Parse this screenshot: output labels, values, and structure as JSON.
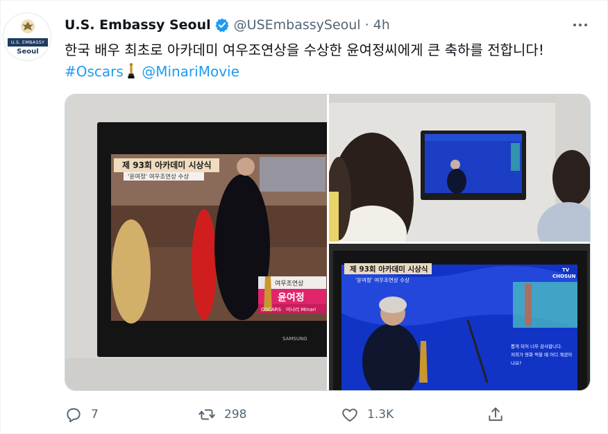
{
  "author": {
    "display_name": "U.S. Embassy Seoul",
    "handle": "@USEmbassySeoul",
    "separator": "·",
    "time": "4h",
    "avatar_banner": "U.S. EMBASSY",
    "avatar_city": "Seoul",
    "verified": true
  },
  "tweet": {
    "text_main": "한국 배우 최초로 아카데미 여우조연상을 수상한 윤여정씨에게 큰 축하를 전합니다!",
    "hashtag": "#Oscars",
    "mention": "@MinariMovie"
  },
  "media": {
    "photo1": {
      "banner_title": "제 93회 아카데미 시상식",
      "banner_subtitle": "'윤여정' 여우조연상 수상",
      "award_label": "여우조연상",
      "winner_name": "윤여정",
      "award_brand": "OSCARS",
      "film_label": "미나리 Minari",
      "tv_brand": "SAMSUNG"
    },
    "photo3": {
      "banner_title": "제 93회 아카데미 시상식",
      "banner_subtitle": "'윤여정' 여우조연상 수상",
      "channel_top": "TV",
      "channel_name": "CHOSUN",
      "subtitle_line1": "뽑게 되어 너무 감사합니다.",
      "subtitle_line2": "저희가 영화 찍을 때 어디 계셨어",
      "subtitle_line3": "나요?"
    }
  },
  "actions": {
    "replies": "7",
    "retweets": "298",
    "likes": "1.3K"
  },
  "colors": {
    "link": "#1d9bf0",
    "secondary_text": "#536471",
    "verified": "#1d9bf0"
  },
  "icons": [
    "verified-badge-icon",
    "more-icon",
    "reply-icon",
    "retweet-icon",
    "like-icon",
    "share-icon",
    "oscar-statuette-icon"
  ]
}
